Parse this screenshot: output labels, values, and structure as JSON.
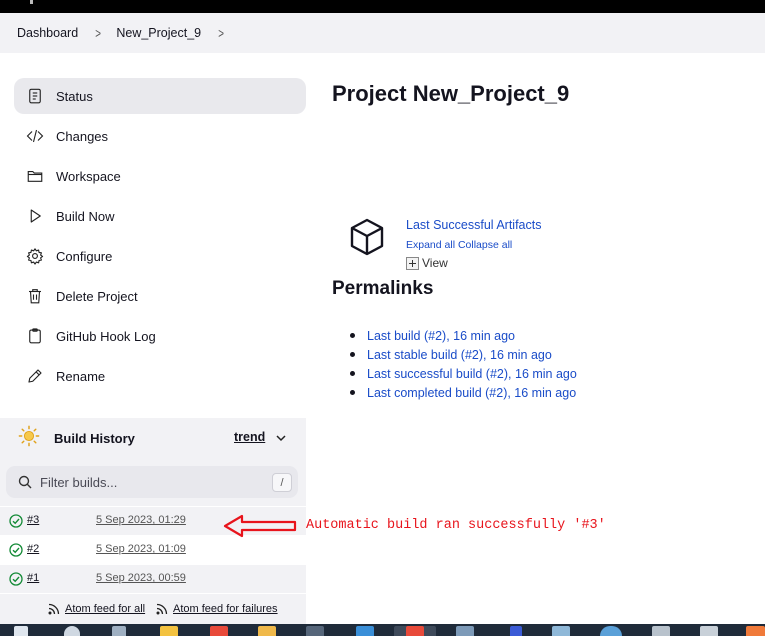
{
  "breadcrumbs": [
    "Dashboard",
    "New_Project_9"
  ],
  "sidebar": {
    "tasks": [
      {
        "label": "Status",
        "icon": "document-icon",
        "active": true
      },
      {
        "label": "Changes",
        "icon": "code-icon"
      },
      {
        "label": "Workspace",
        "icon": "folder-icon"
      },
      {
        "label": "Build Now",
        "icon": "play-icon"
      },
      {
        "label": "Configure",
        "icon": "gear-icon"
      },
      {
        "label": "Delete Project",
        "icon": "trash-icon"
      },
      {
        "label": "GitHub Hook Log",
        "icon": "clipboard-icon"
      },
      {
        "label": "Rename",
        "icon": "pencil-icon"
      }
    ]
  },
  "build_history": {
    "title": "Build History",
    "trend_label": "trend",
    "filter_placeholder": "Filter builds...",
    "shortcut_key": "/",
    "builds": [
      {
        "number": "#3",
        "date": "5 Sep 2023, 01:29",
        "status": "success"
      },
      {
        "number": "#2",
        "date": "5 Sep 2023, 01:09",
        "status": "success"
      },
      {
        "number": "#1",
        "date": "5 Sep 2023, 00:59",
        "status": "success"
      }
    ],
    "feed_all": "Atom feed for all",
    "feed_failures": "Atom feed for failures"
  },
  "main": {
    "title": "Project New_Project_9",
    "artifacts": {
      "link": "Last Successful Artifacts",
      "expand": "Expand all",
      "collapse": "Collapse all",
      "view": "View"
    },
    "permalinks_title": "Permalinks",
    "permalinks": [
      "Last build (#2), 16 min ago",
      "Last stable build (#2), 16 min ago",
      "Last successful build (#2), 16 min ago",
      "Last completed build (#2), 16 min ago"
    ]
  },
  "annotation": {
    "text": "Automatic build ran successfully '#3'",
    "color": "#e8141c"
  },
  "colors": {
    "link": "#1a4cc8",
    "success": "#138a36",
    "sidebar_bg": "#f2f2f5"
  }
}
